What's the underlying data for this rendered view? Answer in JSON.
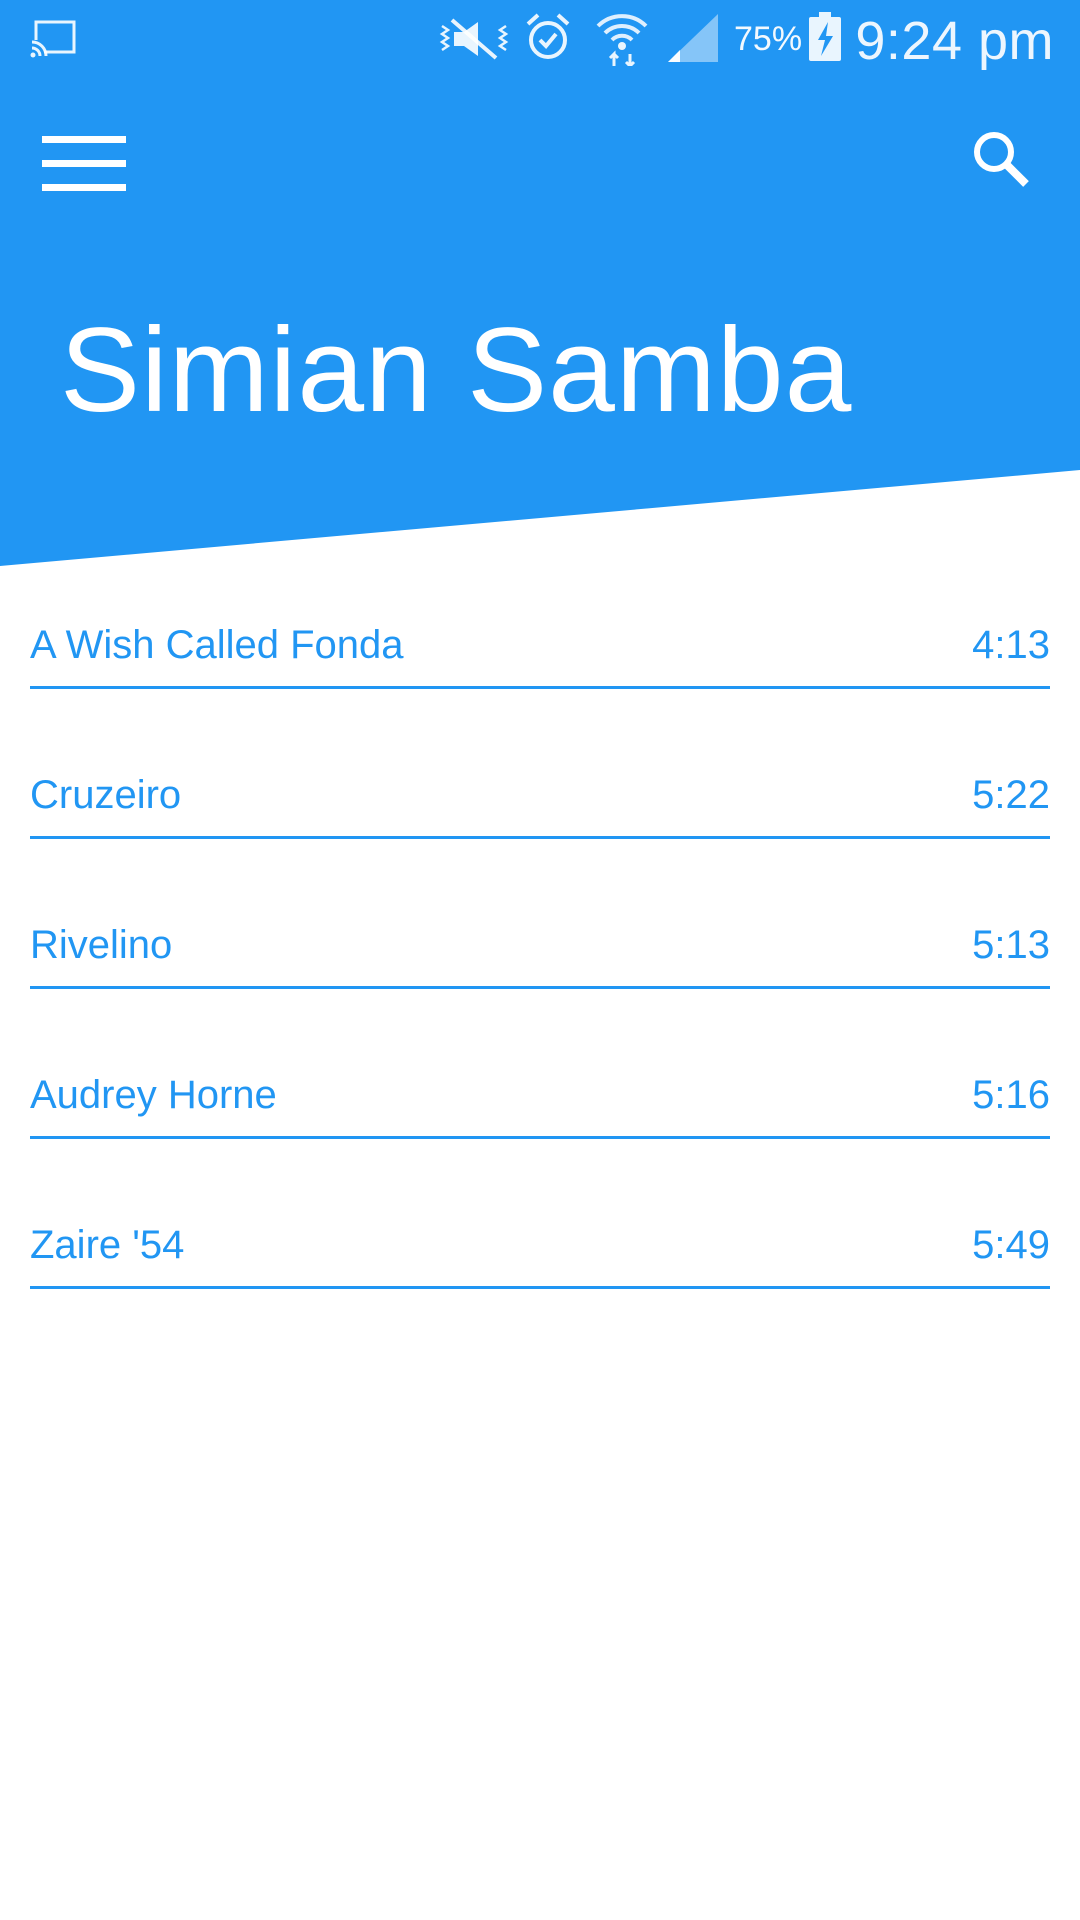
{
  "colors": {
    "primary": "#2196F3",
    "on_primary": "#FFFFFF",
    "background": "#FFFFFF"
  },
  "status_bar": {
    "battery_percent": "75%",
    "time": "9:24 pm",
    "icons": [
      "cast-icon",
      "vibrate-mute-icon",
      "alarm-icon",
      "wifi-icon",
      "signal-icon",
      "battery-charging-icon"
    ]
  },
  "toolbar": {
    "menu_icon": "hamburger-menu-icon",
    "search_icon": "search-icon"
  },
  "album": {
    "title": "Simian Samba"
  },
  "tracks": [
    {
      "title": "A Wish Called Fonda",
      "duration": "4:13"
    },
    {
      "title": "Cruzeiro",
      "duration": "5:22"
    },
    {
      "title": "Rivelino",
      "duration": "5:13"
    },
    {
      "title": "Audrey Horne",
      "duration": "5:16"
    },
    {
      "title": "Zaire '54",
      "duration": "5:49"
    }
  ]
}
